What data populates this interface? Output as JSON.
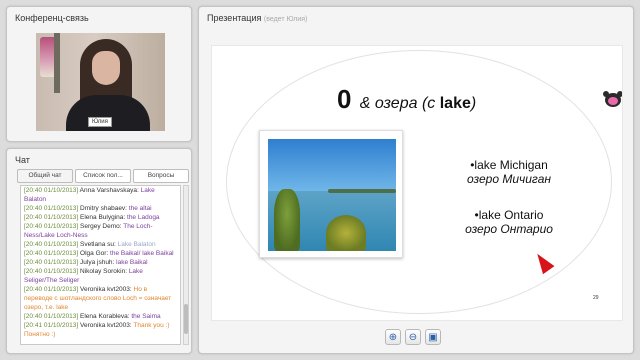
{
  "conference": {
    "title": "Конференц-связь",
    "video_label": "Юлия"
  },
  "chat": {
    "title": "Чат",
    "tabs": [
      "Общий чат",
      "Список пол...",
      "Вопросы"
    ],
    "messages": [
      {
        "time": "[20:40 01/10/2013]",
        "name": "Anna Varshavskaya:",
        "text": "Lake Balaton",
        "color": "purple"
      },
      {
        "time": "[20:40 01/10/2013]",
        "name": "Dmitry shabaev:",
        "text": "the altai",
        "color": "purple"
      },
      {
        "time": "[20:40 01/10/2013]",
        "name": "Elena Bulygina:",
        "text": "the Ladoga",
        "color": "purple"
      },
      {
        "time": "[20:40 01/10/2013]",
        "name": "Sergey Demo:",
        "text": "The Loch-Ness/Lake Loch-Ness",
        "color": "purple"
      },
      {
        "time": "[20:40 01/10/2013]",
        "name": "Svetlana su:",
        "text": "Lake Balaton",
        "color": "lblue"
      },
      {
        "time": "[20:40 01/10/2013]",
        "name": "Olga Gor:",
        "text": "the Baikal/ lake Baikal",
        "color": "purple"
      },
      {
        "time": "[20:40 01/10/2013]",
        "name": "Julya jshuh:",
        "text": "lake Baikal",
        "color": "purple"
      },
      {
        "time": "[20:40 01/10/2013]",
        "name": "Nikolay Sorokin:",
        "text": "Lake Seliger/The Seliger",
        "color": "purple"
      },
      {
        "time": "[20:40 01/10/2013]",
        "name": "Veronika kvt2003:",
        "text": "Но в переводе с шотландского слово Loch = означает озеро, т.е. lake",
        "color": "orange"
      },
      {
        "time": "[20:40 01/10/2013]",
        "name": "Elena Korableva:",
        "text": "the Saima",
        "color": "purple"
      },
      {
        "time": "[20:41 01/10/2013]",
        "name": "Veronika kvt2003:",
        "text": "Thank you :) Понятно :)",
        "color": "orange"
      }
    ]
  },
  "presentation": {
    "title": "Презентация",
    "subtitle": "(ведет Юлия)",
    "slide": {
      "big": "0",
      "rest_before": "& озера (с ",
      "rest_bold": "lake",
      "rest_after": ")",
      "lakes": [
        {
          "en": "•lake Michigan",
          "ru": "озеро Мичиган"
        },
        {
          "en": "•lake Ontario",
          "ru": "озеро Онтарио"
        }
      ],
      "page_number": "29"
    },
    "toolbar": {
      "zoom_in_icon": "zoom-in-icon",
      "zoom_out_icon": "zoom-out-icon",
      "save_icon": "save-icon"
    }
  }
}
